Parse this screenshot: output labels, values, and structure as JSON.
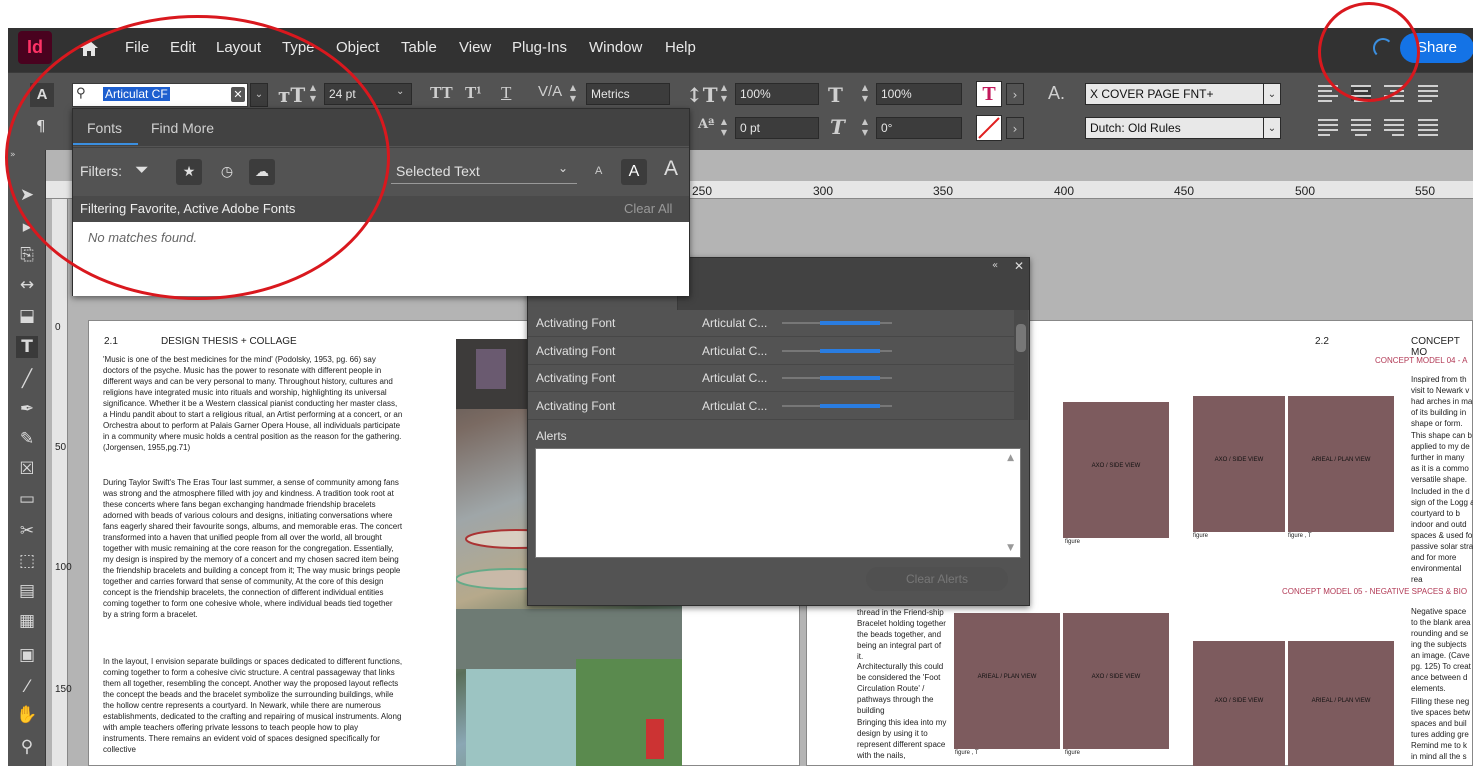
{
  "app": {
    "logo": "Id",
    "share_label": "Share"
  },
  "menu": [
    "File",
    "Edit",
    "Layout",
    "Type",
    "Object",
    "Table",
    "View",
    "Plug-Ins",
    "Window",
    "Help"
  ],
  "control_bar": {
    "font_search_value": "Articulat CF",
    "font_size": "24 pt",
    "kerning": "Metrics",
    "vertical_scale": "100%",
    "horizontal_scale": "100%",
    "baseline_shift": "0 pt",
    "skew": "0°",
    "paragraph_style": "X COVER PAGE FNT+",
    "dictionary": "Dutch: Old Rules"
  },
  "font_panel": {
    "tab_fonts": "Fonts",
    "tab_find_more": "Find More",
    "filters_label": "Filters:",
    "preview_scope": "Selected Text",
    "size_small": "A",
    "size_medium": "A",
    "size_large": "A",
    "status_text": "Filtering Favorite, Active Adobe Fonts",
    "clear_all": "Clear All",
    "no_matches": "No matches found."
  },
  "ruler": {
    "ticks": [
      "250",
      "300",
      "350",
      "400",
      "450",
      "500",
      "550"
    ],
    "left": [
      "0",
      "50",
      "100",
      "150"
    ]
  },
  "activation_panel": {
    "rows": [
      {
        "status": "Activating Font",
        "font": "Articulat C...",
        "progress": 0.55
      },
      {
        "status": "Activating Font",
        "font": "Articulat C...",
        "progress": 0.55
      },
      {
        "status": "Activating Font",
        "font": "Articulat C...",
        "progress": 0.55
      },
      {
        "status": "Activating Font",
        "font": "Articulat C...",
        "progress": 0.55
      }
    ],
    "alerts_label": "Alerts",
    "clear_alerts": "Clear Alerts"
  },
  "page1": {
    "number": "2.1",
    "title": "DESIGN THESIS + COLLAGE",
    "p1": "'Music is one of the best medicines for the mind' (Podolsky, 1953, pg. 66) say doctors of the psyche. Music has the power to resonate with different people in different ways and can be very personal to many. Throughout history, cultures and religions have integrated music into rituals and worship, highlighting its universal significance. Whether it be a Western classical pianist conducting her master class, a Hindu pandit about to start a religious ritual, an Artist performing at a concert, or an Orchestra about to perform at Palais Garner Opera House, all individuals participate in a community where music holds a central position as the reason for the gathering. (Jorgensen, 1955,pg.71)",
    "p2": "During Taylor Swift's The Eras Tour last summer, a sense of community among fans was strong and the atmosphere filled with joy and kindness. A tradition took root at these concerts where fans began exchanging handmade friendship bracelets adorned with beads of various colours and designs, initiating conversations where fans eagerly shared their favourite songs, albums, and memorable eras. The concert transformed into a haven that unified people from all over the world, all brought together with music remaining at the core reason for the congregation. Essentially, my design is inspired by the memory of a concert and my chosen sacred item being the friendship bracelets and building a concept from it; The way music brings people together and carries forward that sense of community, At the core of this design concept is the friendship bracelets, the connection of different individual entities coming together to form one cohesive whole, where individual beads tied together by a string form a bracelet.",
    "p3": "In the layout, I envision separate buildings or spaces dedicated to different functions, coming together to form a cohesive civic structure. A central passageway that links them all together, resembling the concept. Another way the proposed layout reflects the concept the beads and the bracelet symbolize the surrounding buildings, while the hollow centre represents a courtyard. In Newark, while there are numerous establishments, dedicated to the crafting and repairing of musical instruments. Along with ample teachers offering private lessons to teach people how to play instruments. There remains an evident void of spaces designed specifically for collective"
  },
  "page2": {
    "number": "2.2",
    "title": "CONCEPT MO",
    "cm04": "CONCEPT MODEL 04 - A",
    "cm05": "CONCEPT MODEL 05 - NEGATIVE SPACES & BIO",
    "b1": "Inspired from th visit to Newark v had arches in ma of its building in shape or form.",
    "b2": "This shape can b applied to my de further in many as it is a commo versatile shape.",
    "b3": "Included in the d sign of the Logg a courtyard to b indoor and outd spaces & used fo passive solar stra and for more environmental rea",
    "b4": "Negative space to the blank area rounding and se ing the subjects an image. (Cave pg. 125) To creat ance between d elements.",
    "b5": "Filling these neg tive spaces betw spaces and buil tures adding gre",
    "b6": "Remind me to k in mind all the s",
    "left_col": "thread in the Friend-ship Bracelet holding together the beads together, and being an integral part of it.",
    "left_b1": "Architecturally this could be considered the 'Foot Circulation Route' / pathways through the building",
    "left_b2": "Bringing this idea into my design by using it to represent different space with the nails,",
    "labels": {
      "axo": "AXO / SIDE VIEW",
      "arieal": "ARIEAL / PLAN VIEW"
    },
    "captions": {
      "figure": "figure",
      "figure_t": "figure , T"
    }
  }
}
